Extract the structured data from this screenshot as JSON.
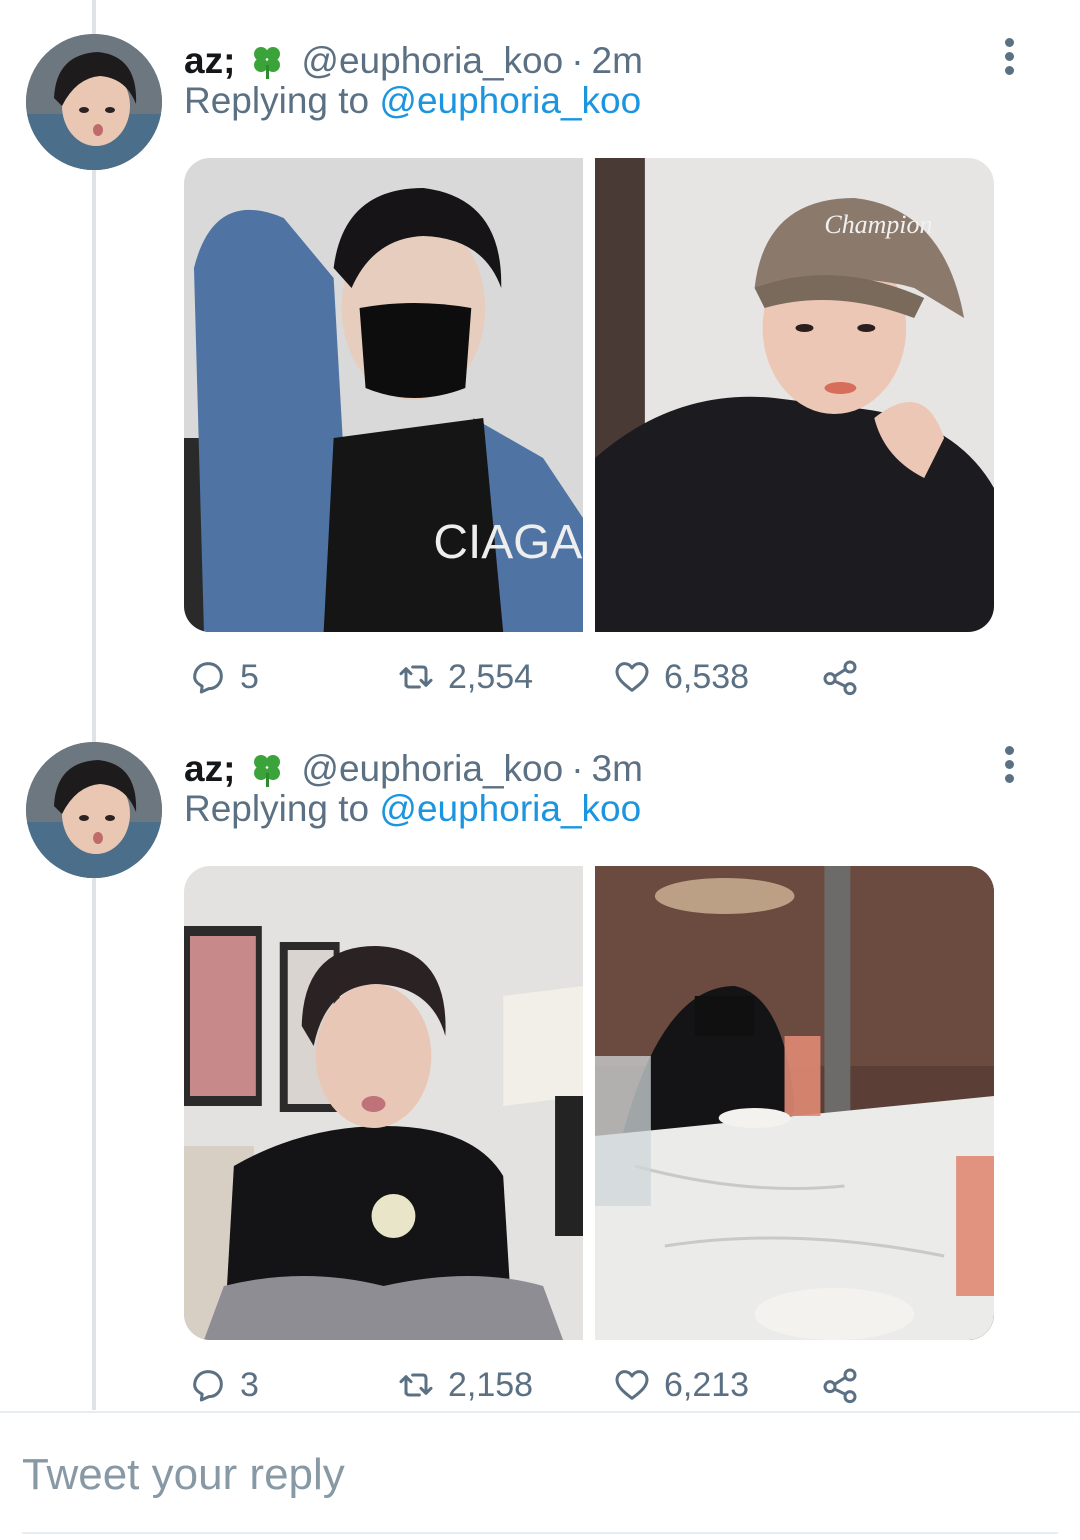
{
  "tweets": [
    {
      "author_name": "az;",
      "emoji": "🍀",
      "handle": "@euphoria_koo",
      "separator": "·",
      "time": "2m",
      "replying_prefix": "Replying to",
      "replying_to": "@euphoria_koo",
      "stats": {
        "replies": "5",
        "retweets": "2,554",
        "likes": "6,538"
      }
    },
    {
      "author_name": "az;",
      "emoji": "🍀",
      "handle": "@euphoria_koo",
      "separator": "·",
      "time": "3m",
      "replying_prefix": "Replying to",
      "replying_to": "@euphoria_koo",
      "stats": {
        "replies": "3",
        "retweets": "2,158",
        "likes": "6,213"
      }
    }
  ],
  "compose": {
    "placeholder": "Tweet your reply"
  },
  "icons": {
    "reply": "reply-icon",
    "retweet": "retweet-icon",
    "like": "heart-icon",
    "share": "share-icon",
    "more": "more-vertical-icon"
  },
  "colors": {
    "link": "#1b95e0",
    "muted": "#5b7083",
    "text": "#14171a"
  }
}
